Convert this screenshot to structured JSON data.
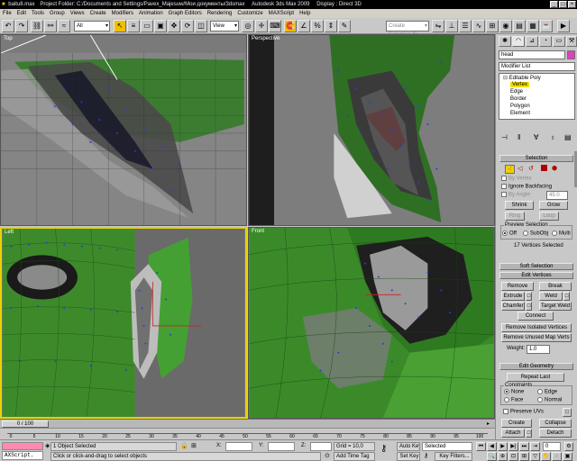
{
  "titlebar": {
    "file": "baitu8.max",
    "project": "Project Folder: C:/Documents and Settings/Pavex_Majesuw/Мои документы/3dsmax",
    "app": "Autodesk 3ds Max  2009",
    "display": "Display : Direct 3D"
  },
  "menubar": [
    "File",
    "Edit",
    "Tools",
    "Group",
    "Views",
    "Create",
    "Modifiers",
    "Animation",
    "Graph Editors",
    "Rendering",
    "Customize",
    "MAXScript",
    "Help"
  ],
  "toolbar": {
    "filter_value": "All",
    "refcoord_value": "View",
    "named_selection_placeholder": "Create Selection Se"
  },
  "viewports": {
    "top": "Top",
    "perspective": "Perspective",
    "left": "Left",
    "front": "Front"
  },
  "panel": {
    "object_name": "head",
    "modifier_list": "Modifier List",
    "stack": [
      "Editable Poly",
      "Vertex",
      "Edge",
      "Border",
      "Polygon",
      "Element"
    ],
    "selection": {
      "title": "Selection",
      "by_vertex": "By Vertex",
      "ignore_backfacing": "Ignore Backfacing",
      "by_angle": "By Angle:",
      "by_angle_value": "45.0",
      "shrink": "Shrink",
      "grow": "Grow",
      "ring": "Ring",
      "loop": "Loop",
      "preview_title": "Preview Selection",
      "preview_off": "Off",
      "preview_subobj": "SubObj",
      "preview_multi": "Multi",
      "status": "17 Vertices Selected"
    },
    "soft_selection": "Soft Selection",
    "edit_vertices": {
      "title": "Edit Vertices",
      "remove": "Remove",
      "break": "Break",
      "extrude": "Extrude",
      "weld": "Weld",
      "chamfer": "Chamfer",
      "target_weld": "Target Weld",
      "connect": "Connect",
      "remove_isolated": "Remove Isolated Vertices",
      "remove_unused": "Remove Unused Map Verts",
      "weight_label": "Weight:",
      "weight_value": "1.0"
    },
    "edit_geometry": {
      "title": "Edit Geometry",
      "repeat_last": "Repeat Last",
      "constraints": "Constraints",
      "none": "None",
      "edge": "Edge",
      "face": "Face",
      "normal": "Normal",
      "preserve_uvs": "Preserve UVs",
      "create": "Create",
      "collapse": "Collapse",
      "attach": "Attach",
      "detach": "Detach"
    }
  },
  "timeslider": {
    "label": "0 / 100"
  },
  "trackbar": {
    "ticks": [
      "0",
      "5",
      "10",
      "15",
      "20",
      "25",
      "30",
      "35",
      "40",
      "45",
      "50",
      "55",
      "60",
      "65",
      "70",
      "75",
      "80",
      "85",
      "90",
      "95",
      "100"
    ]
  },
  "statusbar": {
    "maxscript": "AXScript.",
    "selected": "1 Object Selected",
    "prompt": "Click or click-and-drag to select objects",
    "x_label": "X:",
    "y_label": "Y:",
    "z_label": "Z:",
    "grid": "Grid = 10,0",
    "add_time_tag": "Add Time Tag",
    "auto_key": "Auto Key",
    "selected_value": "Selected",
    "set_key": "Set Key",
    "key_filters": "Key Filters...",
    "frame": "0"
  },
  "colors": {
    "mesh_green": "#3e8a2a",
    "vertex_blue": "#1f3fe0",
    "active_border": "#e8d200",
    "viewport_bg": "#7d7d7d"
  }
}
